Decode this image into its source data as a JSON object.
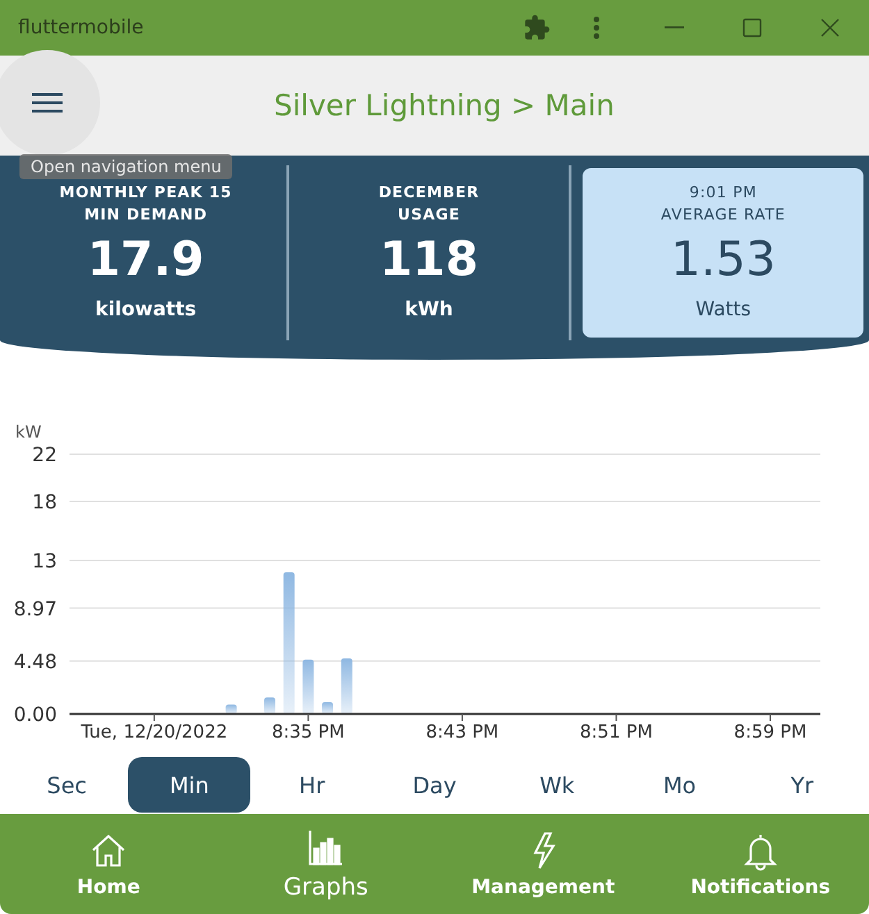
{
  "window": {
    "title": "fluttermobile"
  },
  "app_bar": {
    "title": "Silver Lightning > Main",
    "tooltip": "Open navigation menu"
  },
  "stats": [
    {
      "heading": [
        "MONTHLY PEAK 15",
        "MIN DEMAND"
      ],
      "value": "17.9",
      "unit": "kilowatts",
      "selected": false
    },
    {
      "heading": [
        "DECEMBER",
        "USAGE"
      ],
      "value": "118",
      "unit": "kWh",
      "selected": false
    },
    {
      "heading": [
        "9:01 PM",
        "AVERAGE RATE"
      ],
      "value": "1.53",
      "unit": "Watts",
      "selected": true
    }
  ],
  "chart": {
    "chart_data": {
      "type": "bar",
      "ylabel": "kW",
      "categories": [
        null,
        null,
        null,
        null,
        "Tue, 12/20/2022",
        null,
        null,
        null,
        null,
        null,
        null,
        null,
        "8:35 PM",
        null,
        null,
        null,
        null,
        null,
        null,
        null,
        "8:43 PM",
        null,
        null,
        null,
        null,
        null,
        null,
        null,
        "8:51 PM",
        null,
        null,
        null,
        null,
        null,
        null,
        null,
        "8:59 PM",
        null,
        null
      ],
      "series": [
        {
          "color": "#8fb8e2",
          "values": [
            null,
            null,
            null,
            null,
            null,
            null,
            null,
            null,
            0.8,
            null,
            1.4,
            12.0,
            4.6,
            1.0,
            4.7,
            null,
            null,
            null,
            null,
            null,
            null,
            null,
            null,
            null,
            null,
            null,
            null,
            null,
            null,
            null,
            null,
            null,
            null,
            null,
            null,
            null,
            null,
            null,
            null
          ]
        }
      ],
      "ylim": [
        0,
        22
      ],
      "grid": true,
      "yticks": [
        {
          "value": 0,
          "label": "0.00"
        },
        {
          "value": 4.48,
          "label": "4.48"
        },
        {
          "value": 8.97,
          "label": "8.97"
        },
        {
          "value": 13,
          "label": "13"
        },
        {
          "value": 18,
          "label": "18"
        },
        {
          "value": 22,
          "label": "22"
        }
      ]
    }
  },
  "periods": [
    {
      "label": "Sec",
      "selected": false
    },
    {
      "label": "Min",
      "selected": true
    },
    {
      "label": "Hr",
      "selected": false
    },
    {
      "label": "Day",
      "selected": false
    },
    {
      "label": "Wk",
      "selected": false
    },
    {
      "label": "Mo",
      "selected": false
    },
    {
      "label": "Yr",
      "selected": false
    }
  ],
  "nav": [
    {
      "kind": "home",
      "label": "Home",
      "selected": false
    },
    {
      "kind": "graphs",
      "label": "Graphs",
      "selected": true
    },
    {
      "kind": "management",
      "label": "Management",
      "selected": false
    },
    {
      "kind": "notifications",
      "label": "Notifications",
      "selected": false
    }
  ]
}
